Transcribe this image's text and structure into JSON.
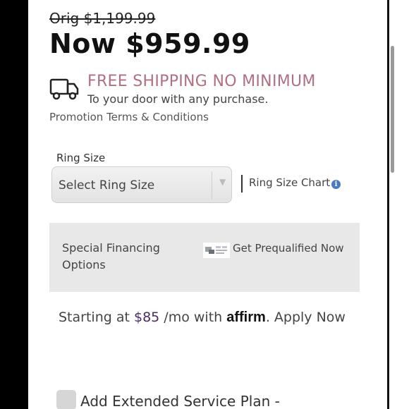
{
  "price": {
    "original": "Orig $1,199.99",
    "current": "Now $959.99"
  },
  "shipping": {
    "icon": "truck-icon",
    "title": "FREE SHIPPING NO MINIMUM",
    "subtitle": "To your door with any purchase.",
    "title_color": "#b07080"
  },
  "promotion": {
    "terms_link": "Promotion Terms & Conditions"
  },
  "ring_size": {
    "label": "Ring Size",
    "select_value": "Select Ring Size",
    "chart_link": "Ring Size Chart",
    "info_icon": "info-icon",
    "info_glyph": "i"
  },
  "financing": {
    "label": "Special Financing Options",
    "prequal_link": "Get Prequalified Now"
  },
  "affirm": {
    "prefix": "Starting at",
    "amount": "$85",
    "per_month_with": "/mo with",
    "brand": "affirm",
    "apply": ". Apply Now",
    "amount_color": "#4a2a66"
  },
  "service_plan": {
    "label": "Add Extended Service Plan -"
  }
}
